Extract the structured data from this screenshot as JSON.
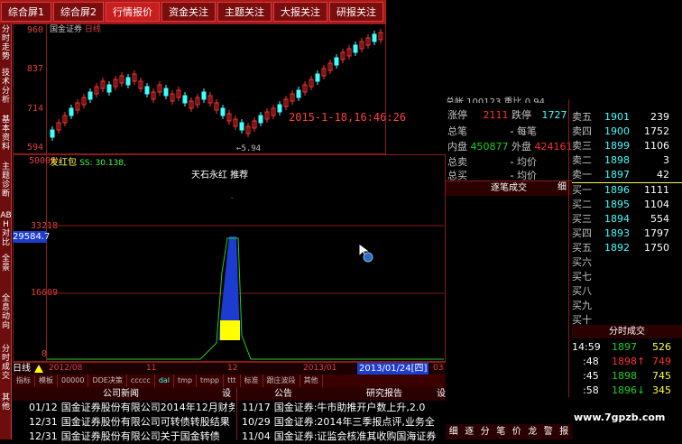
{
  "top_tabs": [
    "综合屏1",
    "综合屏2",
    "行情报价",
    "资金关注",
    "主题关注",
    "大报关注",
    "研报关注"
  ],
  "left_tabs": [
    "分时走势",
    "技术分析",
    "基本资料",
    "主题诊断",
    "ABH对比",
    "全景",
    "全息动向",
    "分时成交",
    "其他"
  ],
  "kchart": {
    "stock_name": "国金证券",
    "period": "日线",
    "y_labels": [
      "960",
      "837",
      "714",
      "594"
    ],
    "low_label": "5.94",
    "timestamp": "2015-1-18,16:46:26"
  },
  "vchart": {
    "indicator": "发红包",
    "indicator_value": "SS: 30.138,",
    "y_labels": [
      "50000",
      "33218",
      "16609",
      "0"
    ],
    "cursor_value": "29584.7",
    "annotation": "天石永红 推荐"
  },
  "date_axis": {
    "period_label": "日线",
    "dates": [
      "2012/08",
      "11",
      "12",
      "2013/01"
    ],
    "cursor_date": "2013/01/24[四]",
    "last": "03"
  },
  "indicator_tabs": [
    "指标",
    "模板",
    "00000",
    "DDE决策",
    "ccccc",
    "dal",
    "tmp",
    "tmpp",
    "ttt",
    "标准",
    "跟庄波段",
    "其他"
  ],
  "news": {
    "company_header": "公司新闻",
    "notice_header": "公告",
    "research_header": "研究报告",
    "settings_btn": "设",
    "company_items": [
      {
        "date": "01/12",
        "text": "国金证券股份有限公司2014年12月财务"
      },
      {
        "date": "12/31",
        "text": "国金证券股份有限公司可转债转股结果"
      },
      {
        "date": "12/31",
        "text": "国金证券股份有限公司关于国金转债"
      }
    ],
    "notice_items": [
      {
        "date": "11/17",
        "text": "国金证券:牛市助推开户数上升,2.0"
      },
      {
        "date": "10/29",
        "text": "国金证券:2014年三季报点评,业务全"
      },
      {
        "date": "11/04",
        "text": "国金证券:证监会核准其收购国海证券"
      }
    ]
  },
  "quote": {
    "partial_top": "总帐  100123  重比  0.94",
    "rows": [
      {
        "label": "涨停",
        "v1": "2111",
        "label2": "跌停",
        "v2": "1727"
      },
      {
        "label": "总笔",
        "v1": "-",
        "label2": "每笔",
        "v2": ""
      },
      {
        "label": "内盘",
        "v1": "450877",
        "label2": "外盘",
        "v2": "424161"
      },
      {
        "label": "总卖",
        "v1": "-",
        "label2": "均价",
        "v2": ""
      },
      {
        "label": "总买",
        "v1": "-",
        "label2": "均价",
        "v2": ""
      }
    ],
    "trade_header": "逐笔成交",
    "trade_detail": "细",
    "sells": [
      {
        "label": "卖五",
        "price": "1901",
        "vol": "239"
      },
      {
        "label": "卖四",
        "price": "1900",
        "vol": "1752"
      },
      {
        "label": "卖三",
        "price": "1899",
        "vol": "1106"
      },
      {
        "label": "卖二",
        "price": "1898",
        "vol": "3"
      },
      {
        "label": "卖一",
        "price": "1897",
        "vol": "42"
      }
    ],
    "buys": [
      {
        "label": "买一",
        "price": "1896",
        "vol": "1111"
      },
      {
        "label": "买二",
        "price": "1895",
        "vol": "1104"
      },
      {
        "label": "买三",
        "price": "1894",
        "vol": "554"
      },
      {
        "label": "买四",
        "price": "1893",
        "vol": "1797"
      },
      {
        "label": "买五",
        "price": "1892",
        "vol": "1750"
      },
      {
        "label": "买六",
        "price": "",
        "vol": ""
      },
      {
        "label": "买七",
        "price": "",
        "vol": ""
      },
      {
        "label": "买八",
        "price": "",
        "vol": ""
      },
      {
        "label": "买九",
        "price": "",
        "vol": ""
      },
      {
        "label": "买十",
        "price": "",
        "vol": ""
      }
    ],
    "tick_header": "分时成交",
    "ticks": [
      {
        "time": "14:59",
        "price": "1897",
        "arrow": "",
        "vol": "526"
      },
      {
        "time": ":48",
        "price": "1898",
        "arrow": "↑",
        "vol": "749"
      },
      {
        "time": ":45",
        "price": "1898",
        "arrow": "",
        "vol": "745"
      },
      {
        "time": ":58",
        "price": "1896",
        "arrow": "↓",
        "vol": "345"
      }
    ],
    "bottom_tabs": [
      "细",
      "逐",
      "分",
      "笔",
      "价",
      "龙",
      "警",
      "报"
    ]
  },
  "watermark": "www.7gpzb.com",
  "colors": {
    "up": "#ff3030",
    "down": "#40ffff",
    "accent": "#b01818",
    "bar_blue": "#1c3cd0",
    "bar_yellow": "#ffff00"
  }
}
